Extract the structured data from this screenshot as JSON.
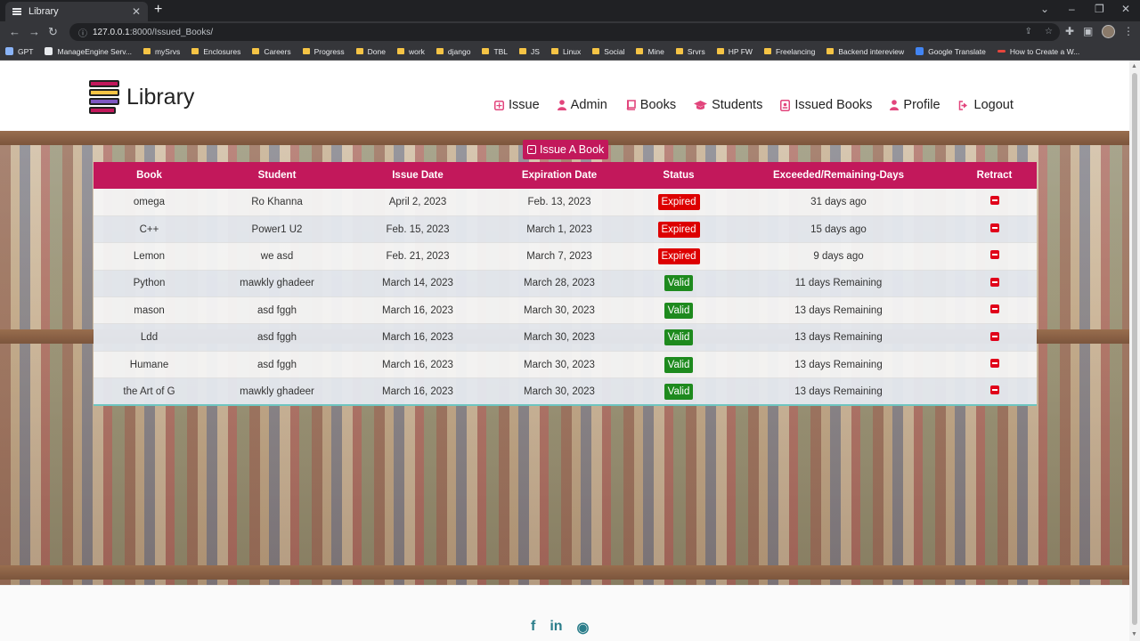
{
  "browser": {
    "tab_title": "Library",
    "url_host": "127.0.0.1",
    "url_rest": ":8000/Issued_Books/",
    "bookmarks": [
      "GPT",
      "ManageEngine Serv...",
      "mySrvs",
      "Enclosures",
      "Careers",
      "Progress",
      "Done",
      "work",
      "django",
      "TBL",
      "JS",
      "Linux",
      "Social",
      "Mine",
      "Srvrs",
      "HP FW",
      "Freelancing",
      "Backend intereview",
      "Google Translate",
      "How to Create a W..."
    ]
  },
  "site": {
    "brand": "Library",
    "nav": [
      {
        "label": "Issue",
        "icon": "plus-square-icon"
      },
      {
        "label": "Admin",
        "icon": "user-icon"
      },
      {
        "label": "Books",
        "icon": "book-icon"
      },
      {
        "label": "Students",
        "icon": "graduation-cap-icon"
      },
      {
        "label": "Issued Books",
        "icon": "id-badge-icon"
      },
      {
        "label": "Profile",
        "icon": "user-icon"
      },
      {
        "label": "Logout",
        "icon": "sign-out-icon"
      }
    ],
    "issue_button": "Issue A Book"
  },
  "table": {
    "headers": [
      "Book",
      "Student",
      "Issue Date",
      "Expiration Date",
      "Status",
      "Exceeded/Remaining-Days",
      "Retract"
    ],
    "rows": [
      {
        "book": "omega",
        "student": "Ro Khanna",
        "issue_date": "April 2, 2023",
        "expiration_date": "Feb. 13, 2023",
        "status": "Expired",
        "days": "31 days ago"
      },
      {
        "book": "C++",
        "student": "Power1 U2",
        "issue_date": "Feb. 15, 2023",
        "expiration_date": "March 1, 2023",
        "status": "Expired",
        "days": "15 days ago"
      },
      {
        "book": "Lemon",
        "student": "we asd",
        "issue_date": "Feb. 21, 2023",
        "expiration_date": "March 7, 2023",
        "status": "Expired",
        "days": "9 days ago"
      },
      {
        "book": "Python",
        "student": "mawkly ghadeer",
        "issue_date": "March 14, 2023",
        "expiration_date": "March 28, 2023",
        "status": "Valid",
        "days": "11 days Remaining"
      },
      {
        "book": "mason",
        "student": "asd fggh",
        "issue_date": "March 16, 2023",
        "expiration_date": "March 30, 2023",
        "status": "Valid",
        "days": "13 days Remaining"
      },
      {
        "book": "Ldd",
        "student": "asd fggh",
        "issue_date": "March 16, 2023",
        "expiration_date": "March 30, 2023",
        "status": "Valid",
        "days": "13 days Remaining"
      },
      {
        "book": "Humane",
        "student": "asd fggh",
        "issue_date": "March 16, 2023",
        "expiration_date": "March 30, 2023",
        "status": "Valid",
        "days": "13 days Remaining"
      },
      {
        "book": "the Art of G",
        "student": "mawkly ghadeer",
        "issue_date": "March 16, 2023",
        "expiration_date": "March 30, 2023",
        "status": "Valid",
        "days": "13 days Remaining"
      }
    ]
  },
  "footer": {
    "socials": [
      {
        "label": "f",
        "icon": "facebook-icon"
      },
      {
        "label": "in",
        "icon": "linkedin-icon"
      },
      {
        "label": "◉",
        "icon": "github-icon"
      }
    ]
  },
  "colors": {
    "accent": "#c2185b",
    "nav_icon": "#e2457c",
    "expired": "#dd0000",
    "valid": "#1e8a1e",
    "link": "#6a1b9a"
  }
}
